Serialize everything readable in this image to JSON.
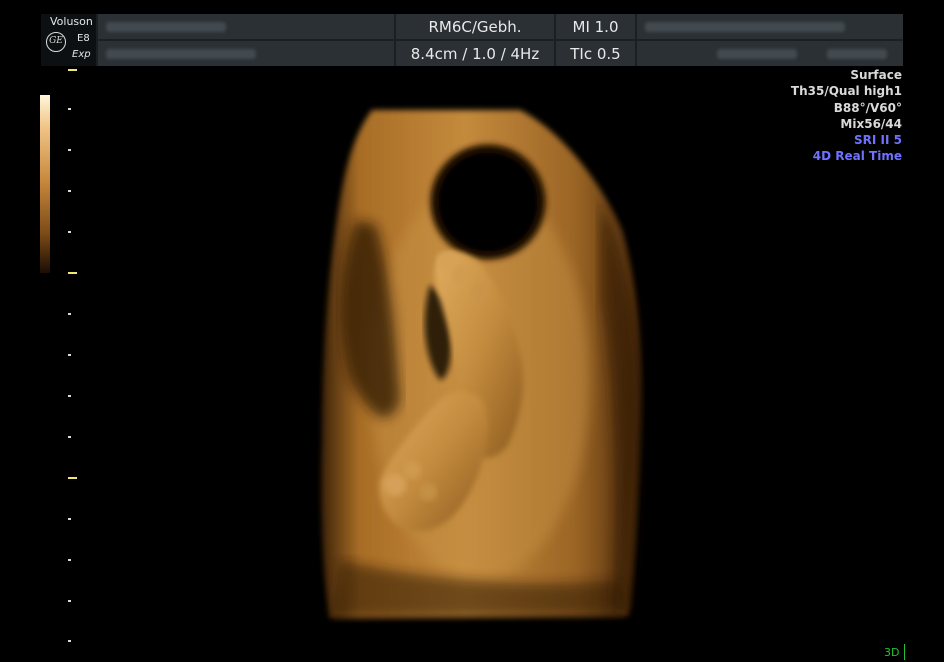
{
  "header": {
    "brand": "Voluson",
    "logo_monogram": "GE",
    "model": "E8",
    "model_suffix": "Exp",
    "probe": "RM6C/Gebh.",
    "mechanical_index": "MI  1.0",
    "depth_rate": "8.4cm / 1.0 /  4Hz",
    "thermal_index": "TIc  0.5"
  },
  "info_panel": {
    "render_mode": "Surface",
    "threshold_quality": "Th35/Qual high1",
    "volume_angles": "B88°/V60°",
    "mix": "Mix56/44",
    "sri": "SRI II 5",
    "mode": "4D Real Time"
  },
  "status": {
    "dimension_badge": "3D"
  },
  "colors": {
    "header_bg": "#1a1f22",
    "cell_bg": "#2a3034",
    "tick_major": "#f0e67a",
    "tick_minor": "#dadada",
    "info_text": "#d9d9d9",
    "info_accent": "#6f72ff",
    "badge": "#22c32e",
    "tissue": "#b98036"
  }
}
